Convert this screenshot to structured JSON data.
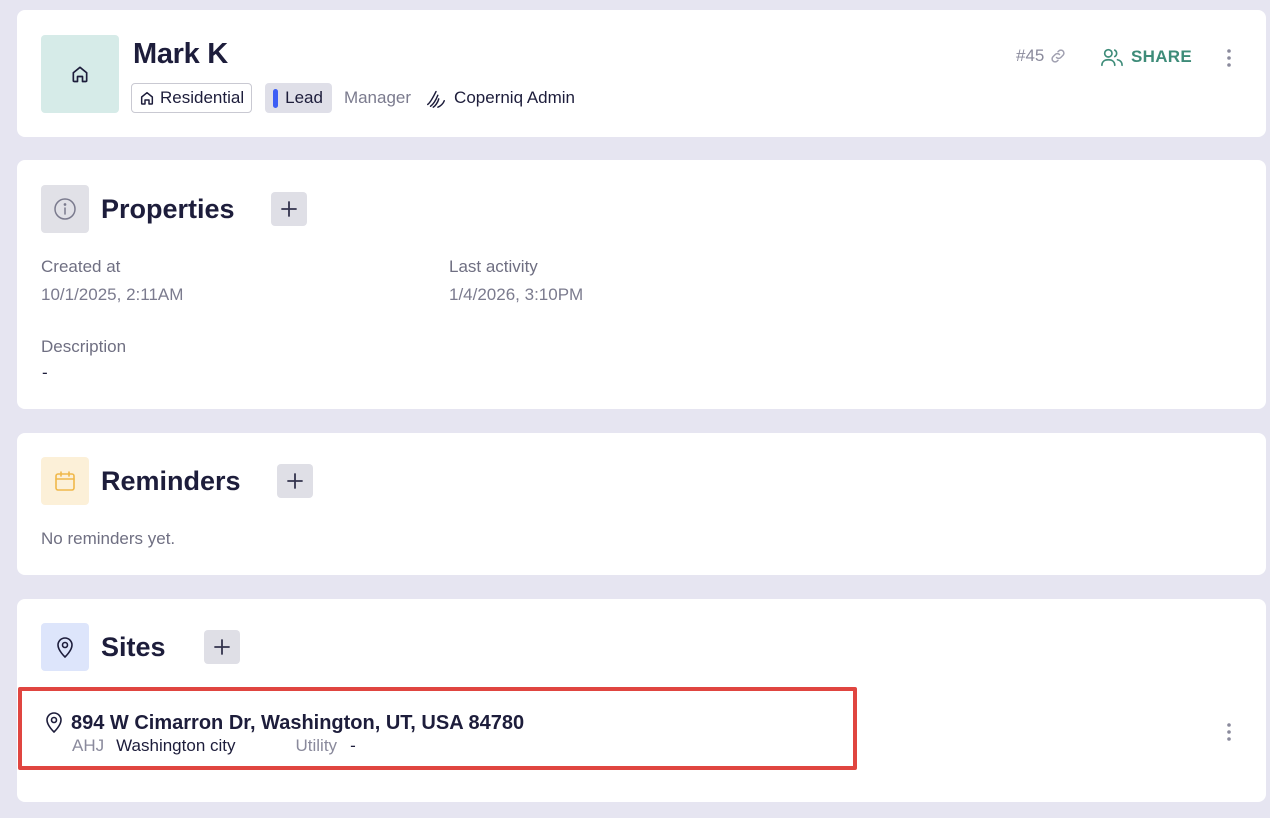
{
  "header": {
    "name": "Mark K",
    "type_tag": "Residential",
    "status_tag": "Lead",
    "manager_label": "Manager",
    "manager_name": "Coperniq Admin",
    "record_id": "#45",
    "share_label": "SHARE"
  },
  "properties": {
    "title": "Properties",
    "created_label": "Created at",
    "created_value": "10/1/2025, 2:11AM",
    "activity_label": "Last activity",
    "activity_value": "1/4/2026, 3:10PM",
    "description_label": "Description",
    "description_value": "-"
  },
  "reminders": {
    "title": "Reminders",
    "empty_text": "No reminders yet."
  },
  "sites": {
    "title": "Sites",
    "items": [
      {
        "address": "894 W Cimarron Dr, Washington, UT, USA 84780",
        "ahj_label": "AHJ",
        "ahj_value": "Washington city",
        "utility_label": "Utility",
        "utility_value": "-"
      }
    ]
  },
  "colors": {
    "page_bg": "#e6e5f1",
    "accent_green": "#3e8c79",
    "lead_blue": "#3d5ef5",
    "highlight_red": "#e04540"
  },
  "icons": {
    "avatar": "home-icon",
    "properties": "info-icon",
    "reminders": "calendar-icon",
    "sites": "map-pin-icon"
  }
}
